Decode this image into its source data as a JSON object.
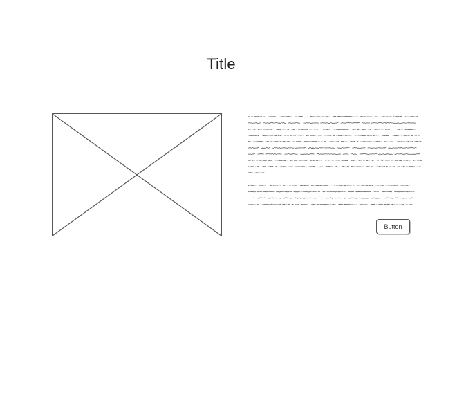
{
  "page": {
    "title": "Title"
  },
  "image_placeholder": {
    "icon": "image-placeholder-cross"
  },
  "content": {
    "paragraph_1": {
      "line_count": 10
    },
    "paragraph_2": {
      "line_count": 4
    }
  },
  "actions": {
    "button_label": "Button"
  },
  "colors": {
    "ink": "#555555",
    "text_scribble": "#666666",
    "background": "#ffffff"
  }
}
